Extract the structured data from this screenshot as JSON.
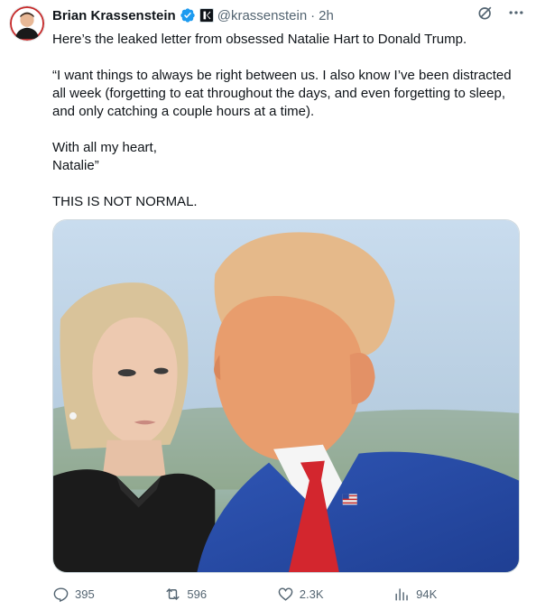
{
  "tweet": {
    "author": {
      "display_name": "Brian Krassenstein",
      "handle": "@krassenstein",
      "separator": "·",
      "time": "2h",
      "verified": true
    },
    "text": {
      "line1": "Here’s the leaked letter from obsessed Natalie Hart to Donald Trump.",
      "quote": "“I want things to always be right between us. I also know I’ve been distracted all week (forgetting to eat throughout the days, and even forgetting to sleep, and only catching a couple hours at a time).",
      "closing1": "With all my heart,",
      "closing2": "Natalie”",
      "remark": "THIS IS NOT NORMAL."
    },
    "media": {
      "type": "photo"
    },
    "stats": {
      "replies": "395",
      "retweets": "596",
      "likes": "2.3K",
      "views": "94K"
    }
  },
  "icons": {
    "verified": "verified-badge-icon",
    "affiliate": "affiliate-badge-icon",
    "grok": "grok-icon",
    "more": "more-options-icon",
    "reply": "reply-icon",
    "retweet": "retweet-icon",
    "like": "heart-icon",
    "views": "views-icon",
    "bookmark": "bookmark-icon",
    "share": "share-icon"
  },
  "colors": {
    "text": "#0f1419",
    "secondary": "#536471",
    "verified": "#1d9bf0",
    "border": "#cfd9de"
  }
}
